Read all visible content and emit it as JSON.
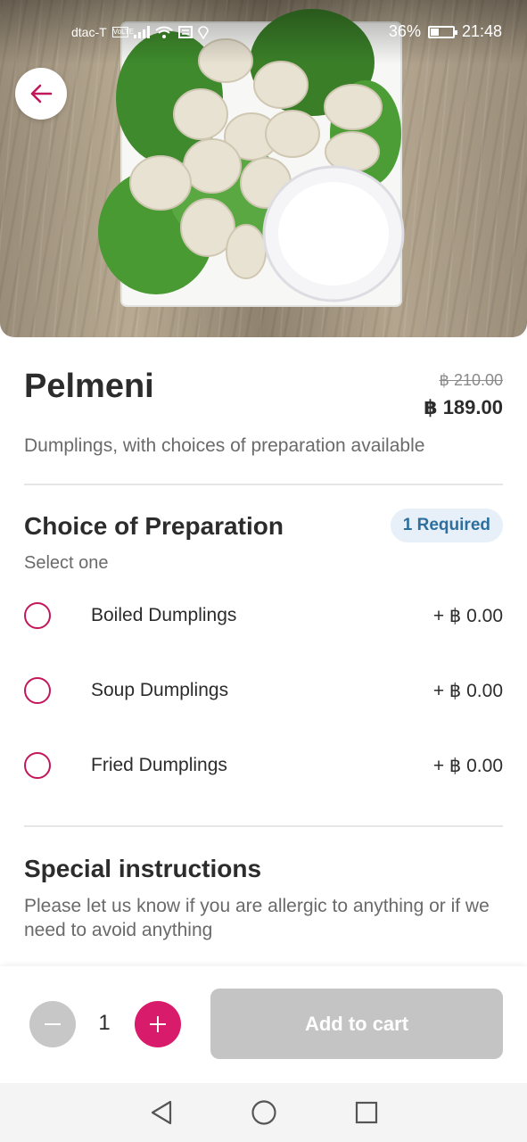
{
  "status_bar": {
    "carrier": "dtac-T",
    "volte": "VoLTE",
    "battery": "36%",
    "time": "21:48"
  },
  "item": {
    "name": "Pelmeni",
    "original_price": "฿ 210.00",
    "price": "฿ 189.00",
    "description": "Dumplings, with choices of preparation available",
    "image_icon": "pelmeni-dumplings-photo"
  },
  "preparation": {
    "title": "Choice of Preparation",
    "badge": "1 Required",
    "subtitle": "Select one",
    "options": [
      {
        "label": "Boiled Dumplings",
        "price": "+ ฿ 0.00"
      },
      {
        "label": "Soup Dumplings",
        "price": "+ ฿ 0.00"
      },
      {
        "label": "Fried Dumplings",
        "price": "+ ฿ 0.00"
      }
    ]
  },
  "instructions": {
    "title": "Special instructions",
    "text": "Please let us know if you are allergic to anything or if we need to avoid anything"
  },
  "cart": {
    "quantity": "1",
    "add_label": "Add to cart"
  },
  "colors": {
    "accent": "#d81b6a",
    "radio": "#c2185b",
    "badge_bg": "#e7f0f8",
    "badge_text": "#2d6f9e",
    "disabled": "#c4c4c4"
  },
  "icons": {
    "back": "arrow-left-icon",
    "minus": "minus-icon",
    "plus": "plus-icon",
    "nav_back": "triangle-back-icon",
    "nav_home": "circle-home-icon",
    "nav_recent": "square-recent-icon"
  }
}
